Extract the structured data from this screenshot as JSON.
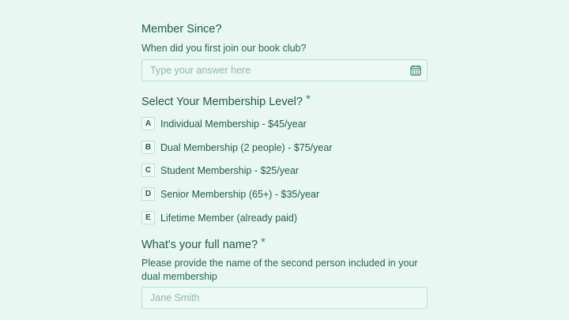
{
  "q_member_since": {
    "title": "Member Since?",
    "description": "When did you first join our book club?",
    "placeholder": "Type your answer here",
    "icon": "calendar-icon"
  },
  "q_membership": {
    "title": "Select Your Membership Level?",
    "required_mark": "*",
    "options": [
      {
        "key": "A",
        "label": "Individual Membership - $45/year"
      },
      {
        "key": "B",
        "label": "Dual Membership (2 people) - $75/year"
      },
      {
        "key": "C",
        "label": "Student Membership - $25/year"
      },
      {
        "key": "D",
        "label": "Senior Membership (65+) - $35/year"
      },
      {
        "key": "E",
        "label": "Lifetime Member (already paid)"
      }
    ]
  },
  "q_full_name": {
    "title": "What's your full name?",
    "required_mark": "*",
    "description": "Please provide the name of the second person included in your dual membership",
    "placeholder": "Jane Smith"
  },
  "colors": {
    "background": "#e8f7f1",
    "text": "#1f5b4f",
    "border": "#b6e2d3"
  }
}
